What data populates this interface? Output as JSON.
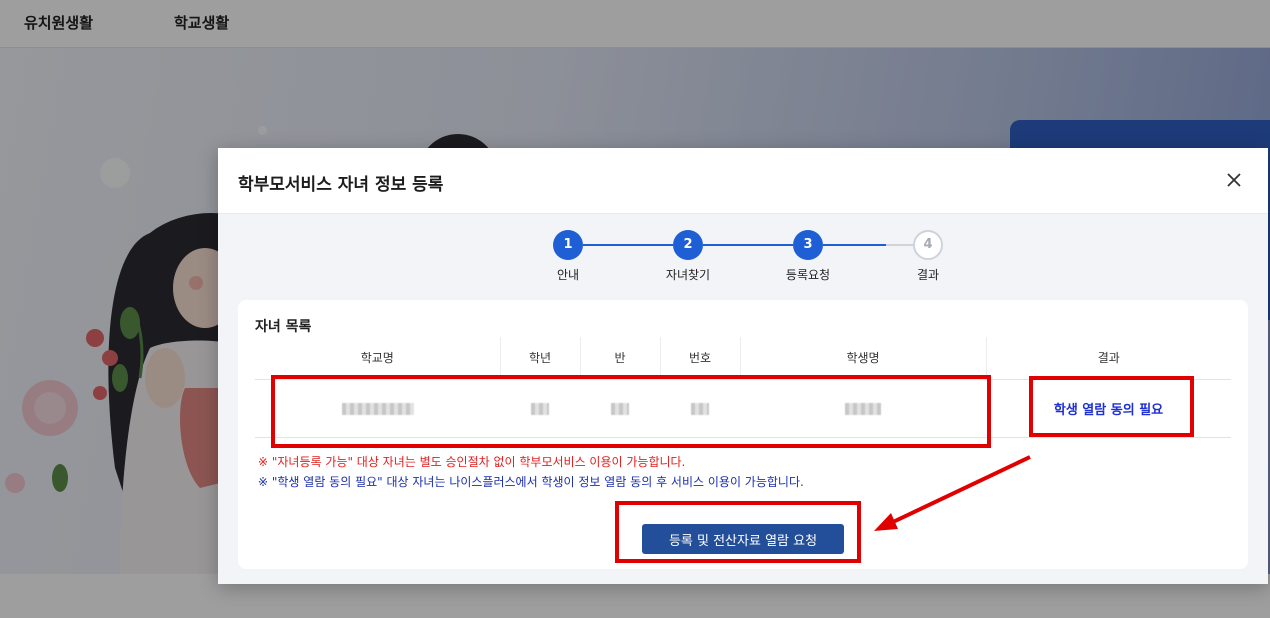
{
  "topnav": {
    "items": [
      "유치원생활",
      "학교생활"
    ]
  },
  "modal": {
    "title": "학부모서비스 자녀 정보 등록",
    "close_icon": "close-icon",
    "steps": [
      {
        "number": "1",
        "label": "안내",
        "state": "done"
      },
      {
        "number": "2",
        "label": "자녀찾기",
        "state": "done"
      },
      {
        "number": "3",
        "label": "등록요청",
        "state": "current"
      },
      {
        "number": "4",
        "label": "결과",
        "state": "pending"
      }
    ],
    "card_title": "자녀 목록",
    "table": {
      "headers": [
        "학교명",
        "학년",
        "반",
        "번호",
        "학생명",
        "결과"
      ],
      "rows": [
        {
          "result": "학생 열람 동의 필요"
        }
      ]
    },
    "notes": {
      "red": "※ \"자녀등록 가능\" 대상 자녀는 별도 승인절차 없이 학부모서비스 이용이 가능합니다.",
      "blue": "※ \"학생 열람 동의 필요\" 대상 자녀는 나이스플러스에서 학생이 정보 열람 동의 후 서비스 이용이 가능합니다."
    },
    "submit_label": "등록 및 전산자료 열람 요청"
  },
  "colors": {
    "step_active": "#1f5fd6",
    "button": "#234e99",
    "highlight": "#e00000",
    "note_red": "#e31f1f",
    "note_blue": "#1c2fae"
  }
}
